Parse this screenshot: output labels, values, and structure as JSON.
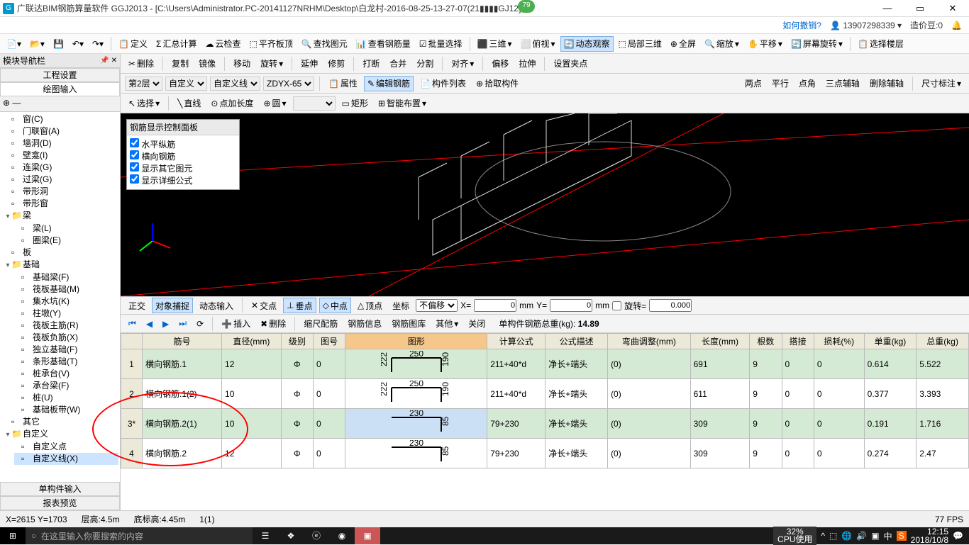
{
  "title": "广联达BIM钢筋算量软件 GGJ2013 - [C:\\Users\\Administrator.PC-20141127NRHM\\Desktop\\白龙村-2016-08-25-13-27-07(21▮▮▮▮GJ12]",
  "badge": "79",
  "infobar": {
    "howto": "如何撤销?",
    "user": "13907298339",
    "coin": "造价豆:0"
  },
  "toolbar1": {
    "define": "定义",
    "sum": "汇总计算",
    "cloud": "云检查",
    "flat": "平齐板顶",
    "find": "查找图元",
    "viewrebar": "查看钢筋量",
    "batch": "批量选择",
    "threeD": "三维",
    "top": "俯视",
    "dyn": "动态观察",
    "local3d": "局部三维",
    "full": "全屏",
    "zoom": "缩放",
    "pan": "平移",
    "screen": "屏幕旋转",
    "floor": "选择楼层"
  },
  "toolbar2": {
    "del": "删除",
    "copy": "复制",
    "mirror": "镜像",
    "move": "移动",
    "rotate": "旋转",
    "extend": "延伸",
    "trim": "修剪",
    "break": "打断",
    "merge": "合并",
    "split": "分割",
    "align": "对齐",
    "offset": "偏移",
    "stretch": "拉伸",
    "setpt": "设置夹点"
  },
  "contextbar": {
    "floor": "第2层",
    "cat": "自定义",
    "subcat": "自定义线",
    "type": "ZDYX-65",
    "attr": "属性",
    "edit": "编辑钢筋",
    "list": "构件列表",
    "pick": "拾取构件",
    "pt2": "两点",
    "parallel": "平行",
    "ptangle": "点角",
    "axis3": "三点辅轴",
    "delaxis": "删除辅轴",
    "dim": "尺寸标注"
  },
  "drawbar": {
    "select": "选择",
    "line": "直线",
    "ptlen": "点加长度",
    "circle": "圆",
    "rect": "矩形",
    "smart": "智能布置"
  },
  "leftpanel": {
    "nav": "模块导航栏",
    "proj": "工程设置",
    "drawin": "绘图输入",
    "tree": [
      {
        "l": "窗(C)"
      },
      {
        "l": "门联窗(A)"
      },
      {
        "l": "墙洞(D)"
      },
      {
        "l": "壁龛(I)"
      },
      {
        "l": "连梁(G)"
      },
      {
        "l": "过梁(G)"
      },
      {
        "l": "带形洞"
      },
      {
        "l": "带形窗"
      },
      {
        "l": "梁",
        "exp": true,
        "children": [
          {
            "l": "梁(L)"
          },
          {
            "l": "圈梁(E)"
          }
        ]
      },
      {
        "l": "板",
        "exp": false
      },
      {
        "l": "基础",
        "exp": true,
        "children": [
          {
            "l": "基础梁(F)"
          },
          {
            "l": "筏板基础(M)"
          },
          {
            "l": "集水坑(K)"
          },
          {
            "l": "柱墩(Y)"
          },
          {
            "l": "筏板主筋(R)"
          },
          {
            "l": "筏板负筋(X)"
          },
          {
            "l": "独立基础(F)"
          },
          {
            "l": "条形基础(T)"
          },
          {
            "l": "桩承台(V)"
          },
          {
            "l": "承台梁(F)"
          },
          {
            "l": "桩(U)"
          },
          {
            "l": "基础板带(W)"
          }
        ]
      },
      {
        "l": "其它",
        "exp": false
      },
      {
        "l": "自定义",
        "exp": true,
        "children": [
          {
            "l": "自定义点"
          },
          {
            "l": "自定义线(X)",
            "sel": true
          }
        ]
      }
    ],
    "single": "单构件输入",
    "report": "报表预览"
  },
  "floatpanel": {
    "title": "钢筋显示控制面板",
    "items": [
      "水平纵筋",
      "横向钢筋",
      "显示其它图元",
      "显示详细公式"
    ]
  },
  "snapbar": {
    "ortho": "正交",
    "objsnap": "对象捕捉",
    "dynin": "动态输入",
    "cross": "交点",
    "perp": "垂点",
    "mid": "中点",
    "vertex": "顶点",
    "coord": "坐标",
    "nooffset": "不偏移",
    "x": "X=",
    "xv": "0",
    "xmm": "mm",
    "y": "Y=",
    "yv": "0",
    "ymm": "mm",
    "rot": "旋转=",
    "rotv": "0.000"
  },
  "tblbar": {
    "insert": "插入",
    "del": "删除",
    "scale": "缩尺配筋",
    "info": "钢筋信息",
    "lib": "钢筋图库",
    "other": "其他",
    "close": "关闭",
    "total": "单构件钢筋总重(kg):",
    "totalval": "14.89"
  },
  "table": {
    "headers": [
      "",
      "筋号",
      "直径(mm)",
      "级别",
      "图号",
      "图形",
      "计算公式",
      "公式描述",
      "弯曲调整(mm)",
      "长度(mm)",
      "根数",
      "搭接",
      "损耗(%)",
      "单重(kg)",
      "总重(kg)"
    ],
    "rows": [
      {
        "n": "1",
        "name": "横向钢筋.1",
        "dia": "12",
        "lvl": "Φ",
        "pic": "0",
        "shape": {
          "t": "250",
          "l": "222",
          "r": "190"
        },
        "formula": "211+40*d",
        "desc": "净长+端头",
        "bend": "(0)",
        "len": "691",
        "count": "9",
        "lap": "0",
        "loss": "0",
        "uw": "0.614",
        "tw": "5.522"
      },
      {
        "n": "2",
        "name": "横向钢筋.1(2)",
        "dia": "10",
        "lvl": "Φ",
        "pic": "0",
        "shape": {
          "t": "250",
          "l": "222",
          "r": "190"
        },
        "formula": "211+40*d",
        "desc": "净长+端头",
        "bend": "(0)",
        "len": "611",
        "count": "9",
        "lap": "0",
        "loss": "0",
        "uw": "0.377",
        "tw": "3.393"
      },
      {
        "n": "3*",
        "name": "横向钢筋.2(1)",
        "dia": "10",
        "lvl": "Φ",
        "pic": "0",
        "shape": {
          "t": "230",
          "r": "85"
        },
        "formula": "79+230",
        "desc": "净长+端头",
        "bend": "(0)",
        "len": "309",
        "count": "9",
        "lap": "0",
        "loss": "0",
        "uw": "0.191",
        "tw": "1.716",
        "sel": true
      },
      {
        "n": "4",
        "name": "横向钢筋.2",
        "dia": "12",
        "lvl": "Φ",
        "pic": "0",
        "shape": {
          "t": "230",
          "r": "85"
        },
        "formula": "79+230",
        "desc": "净长+端头",
        "bend": "(0)",
        "len": "309",
        "count": "9",
        "lap": "0",
        "loss": "0",
        "uw": "0.274",
        "tw": "2.47"
      }
    ]
  },
  "status": {
    "xy": "X=2615 Y=1703",
    "fh": "层高:4.5m",
    "bh": "底标高:4.45m",
    "sel": "1(1)",
    "fps": "77 FPS"
  },
  "taskbar": {
    "search": "在这里输入你要搜索的内容",
    "cpu": "32%",
    "cpulbl": "CPU使用",
    "time": "12:15",
    "date": "2018/10/8"
  }
}
